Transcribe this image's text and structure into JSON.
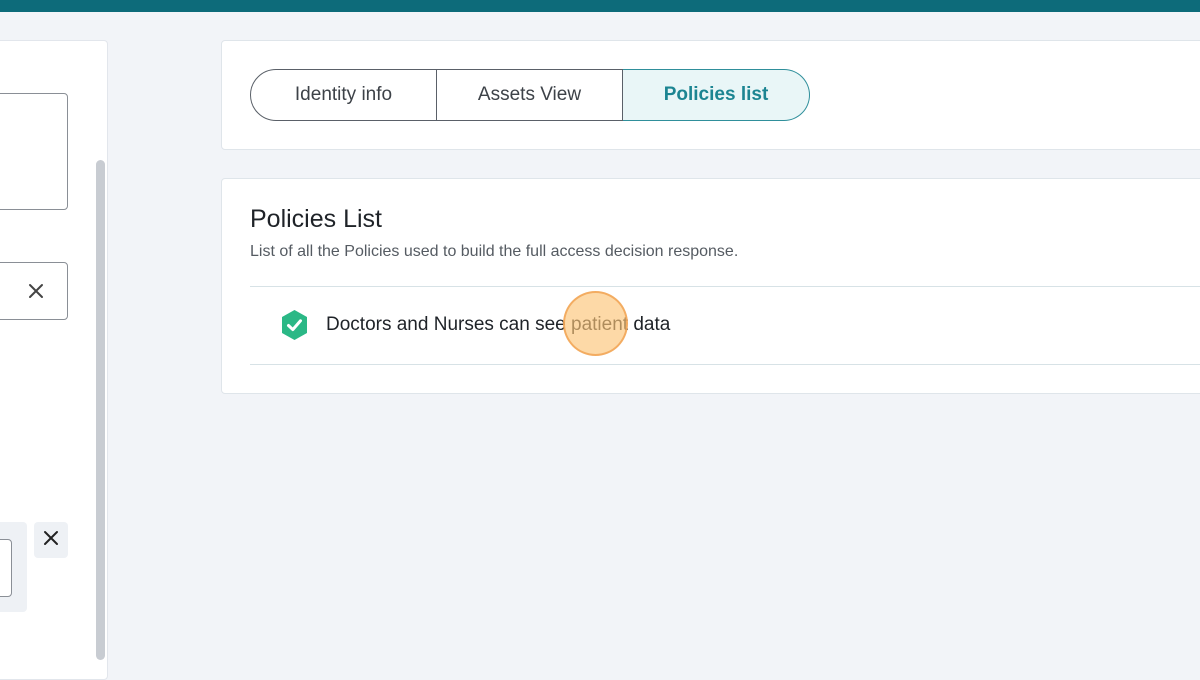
{
  "tabs": [
    {
      "label": "Identity info",
      "active": false
    },
    {
      "label": "Assets View",
      "active": false
    },
    {
      "label": "Policies list",
      "active": true
    }
  ],
  "policies_section": {
    "title": "Policies List",
    "subtitle": "List of all the Policies used to build the full access decision response.",
    "items": [
      {
        "name": "Doctors and Nurses can see patient data",
        "icon": "shield-check-icon",
        "status_color": "#2bb886"
      }
    ]
  },
  "colors": {
    "topbar": "#0d6b7a",
    "active_tab": "#1c8592",
    "active_tab_bg": "#e9f6f7"
  }
}
